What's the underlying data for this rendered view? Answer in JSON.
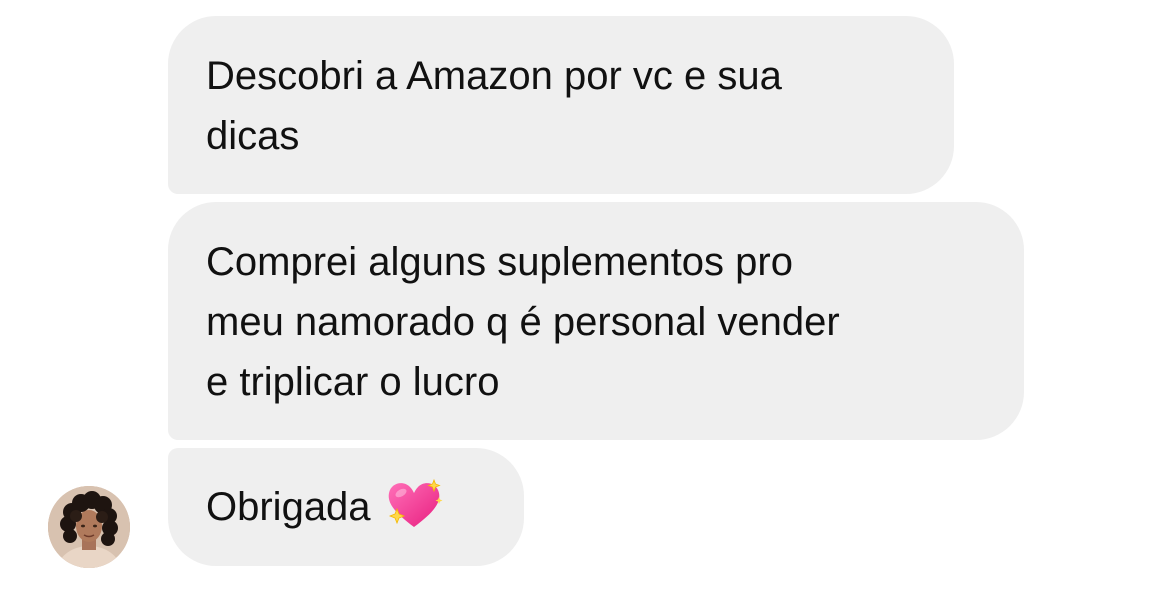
{
  "conversation": {
    "messages": [
      {
        "lines": [
          "Descobri a Amazon por vc e sua",
          "dicas"
        ]
      },
      {
        "lines": [
          "Comprei alguns suplementos pro",
          "meu namorado q é personal vender",
          "e triplicar o lucro"
        ]
      },
      {
        "text": "Obrigada",
        "emoji": "sparkling-heart-icon"
      }
    ],
    "sender_avatar": "avatar-photo"
  },
  "colors": {
    "bubble_background": "#efefef",
    "text": "#111111",
    "heart": "#ff3d9a",
    "sparkle": "#ffd84a"
  }
}
